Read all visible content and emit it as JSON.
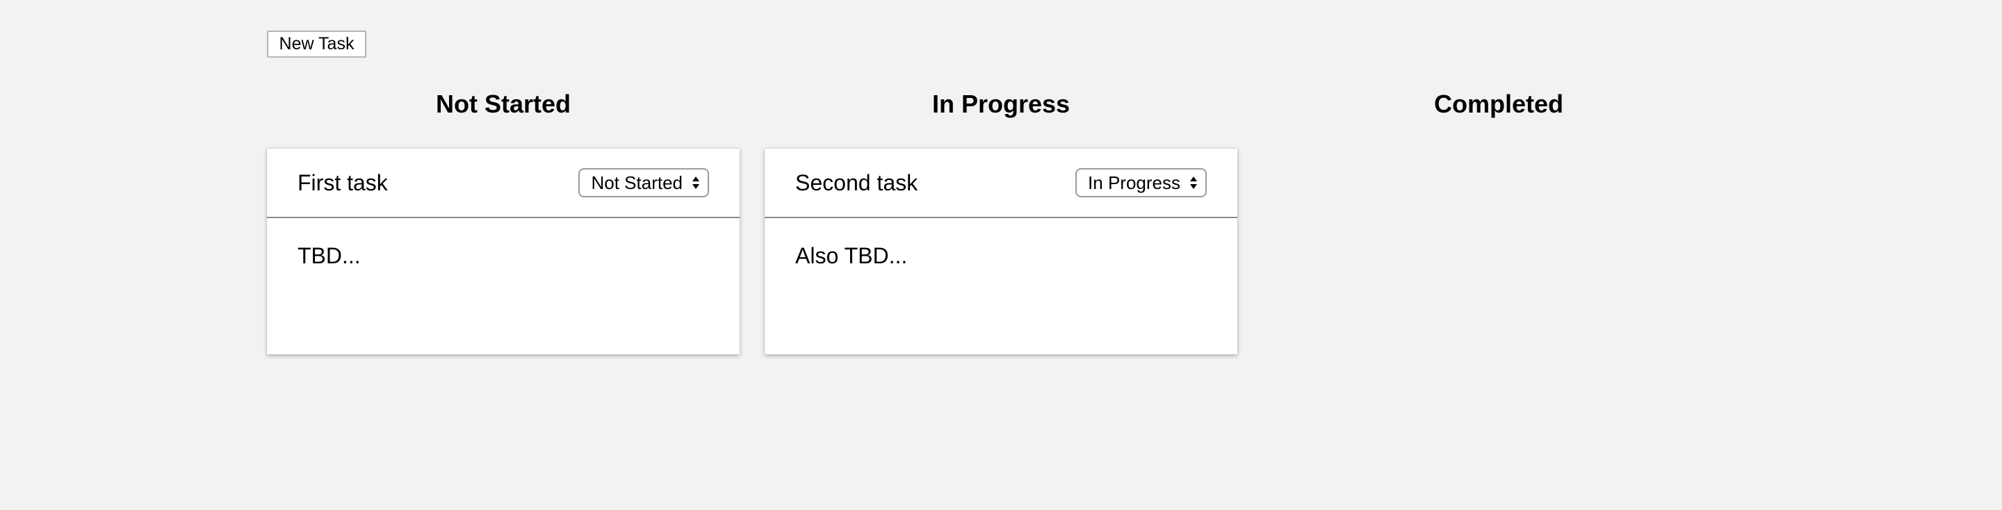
{
  "toolbar": {
    "new_task_label": "New Task"
  },
  "columns": [
    {
      "title": "Not Started",
      "cards": [
        {
          "title": "First task",
          "status": "Not Started",
          "description": "TBD..."
        }
      ]
    },
    {
      "title": "In Progress",
      "cards": [
        {
          "title": "Second task",
          "status": "In Progress",
          "description": "Also TBD..."
        }
      ]
    },
    {
      "title": "Completed",
      "cards": []
    }
  ],
  "colors": {
    "background": "#f2f2f2",
    "card": "#ffffff",
    "divider": "#8a8a8a"
  },
  "icons": {
    "select_arrows": "up-down-arrows-icon"
  }
}
